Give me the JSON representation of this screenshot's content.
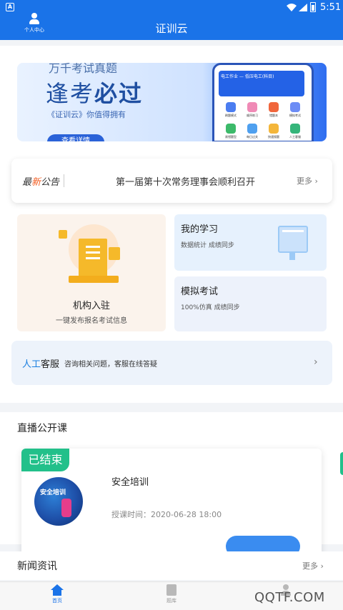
{
  "status": {
    "time": "5:51",
    "left_icon": "A"
  },
  "header": {
    "title": "证训云",
    "profile_label": "个人中心"
  },
  "banner": {
    "top_line": "万千考试真题",
    "slogan_a": "逢考",
    "slogan_b": "必过",
    "tagline": "《证训云》你值得拥有",
    "button": "查看详情",
    "phone_header": "电工作业 — 低压电工(科目)",
    "apps": [
      "刷题模式",
      "顺序练习",
      "错题本",
      "模拟考试",
      "易错题型",
      "每日过关",
      "快速搜题",
      "人工客服"
    ]
  },
  "notice": {
    "tag_a": "最",
    "tag_b": "新",
    "tag_c": "公告",
    "headline": "第一届第十次常务理事会顺利召开",
    "more": "更多"
  },
  "org_card": {
    "title": "机构入驻",
    "subtitle": "一键发布报名考试信息"
  },
  "study_card": {
    "title": "我的学习",
    "subtitle": "数据统计 成绩同步"
  },
  "exam_card": {
    "title": "模拟考试",
    "subtitle": "100%仿真 成绩同步"
  },
  "service": {
    "title_a": "人工",
    "title_b": "客服",
    "desc": "咨询相关问题，客服在线答疑"
  },
  "live": {
    "section_title": "直播公开课",
    "status": "已结束",
    "thumb_text": "安全培训",
    "course_name": "安全培训",
    "time": "授课时间：2020-06-28 18:00"
  },
  "news": {
    "title": "新闻资讯",
    "more": "更多"
  },
  "tabs": [
    {
      "label": "首页",
      "icon": "home-icon"
    },
    {
      "label": "题库",
      "icon": "book-icon"
    },
    {
      "label": "",
      "icon": "user-icon"
    }
  ],
  "watermark": "QQTF.COM",
  "colors": {
    "primary": "#1a73e8",
    "ended_badge": "#22c08a",
    "new_tag": "#f25a1e"
  }
}
